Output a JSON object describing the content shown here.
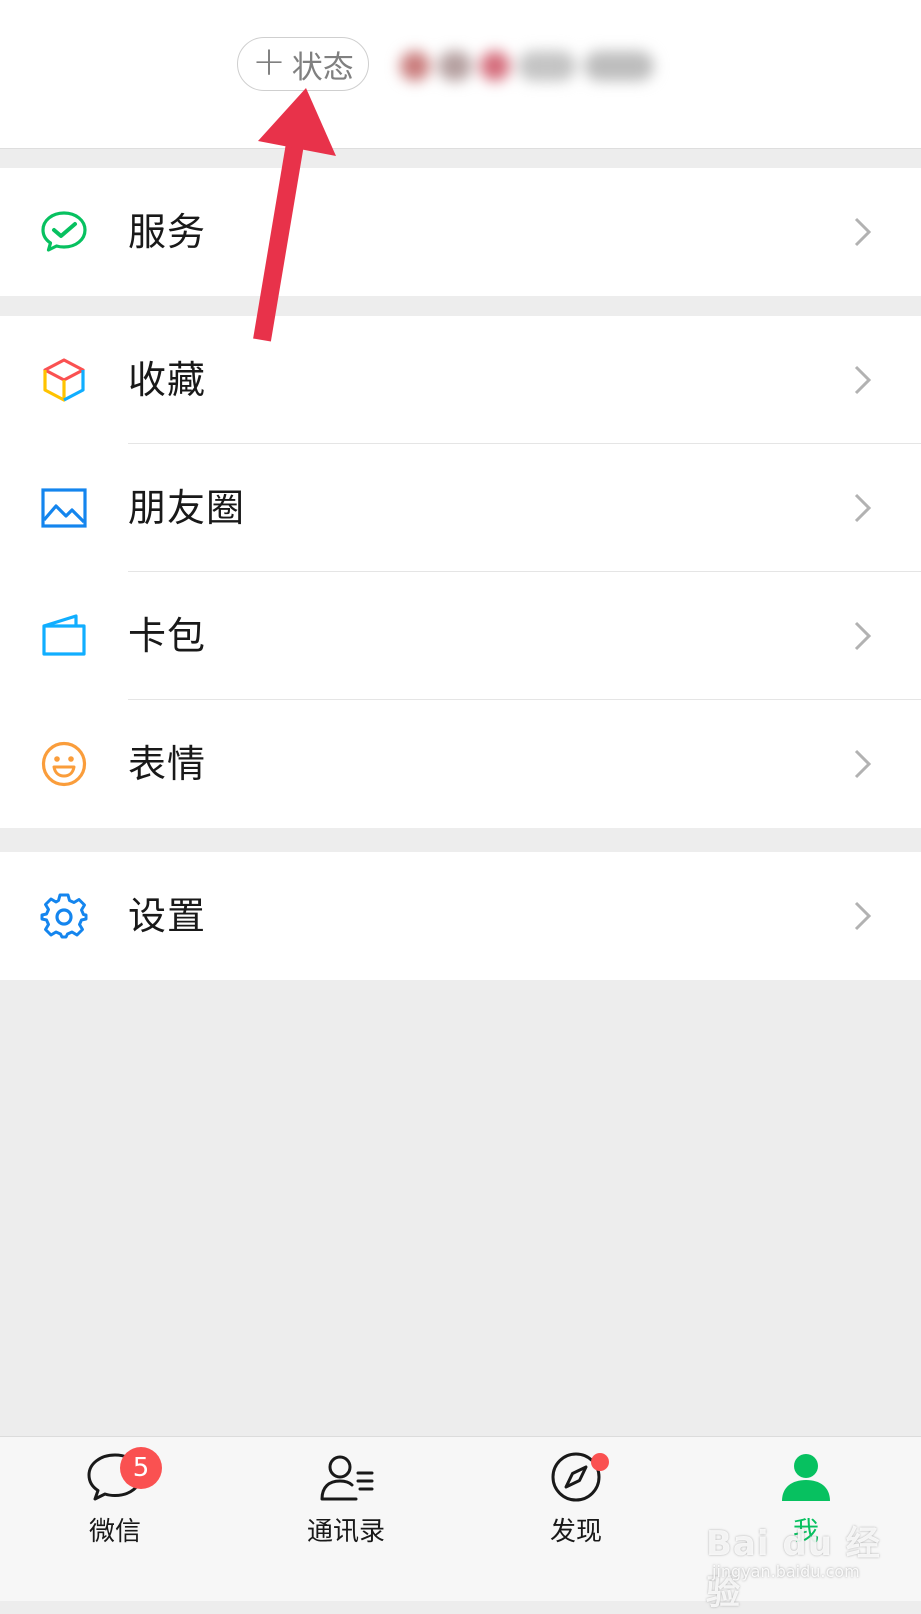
{
  "header": {
    "status_button": {
      "plus": "+",
      "label": "状态"
    }
  },
  "menu": {
    "services": {
      "label": "服务",
      "icon": "wechat-pay-icon"
    },
    "favorites": {
      "label": "收藏",
      "icon": "cube-icon"
    },
    "moments": {
      "label": "朋友圈",
      "icon": "picture-icon"
    },
    "cards": {
      "label": "卡包",
      "icon": "card-icon"
    },
    "stickers": {
      "label": "表情",
      "icon": "smiley-icon"
    },
    "settings": {
      "label": "设置",
      "icon": "gear-icon"
    }
  },
  "tabbar": {
    "tabs": [
      {
        "label": "微信",
        "icon": "chat-bubble-icon",
        "badge": "5"
      },
      {
        "label": "通讯录",
        "icon": "contacts-icon"
      },
      {
        "label": "发现",
        "icon": "compass-icon",
        "has_dot": true
      },
      {
        "label": "我",
        "icon": "person-icon",
        "active": true
      }
    ]
  },
  "watermark": {
    "brand": "Bai du 经验",
    "url": "jingyan.baidu.com"
  },
  "colors": {
    "accent_green": "#07c160",
    "badge_red": "#fa5151",
    "arrow_red": "#e8324a",
    "background": "#ededed"
  }
}
